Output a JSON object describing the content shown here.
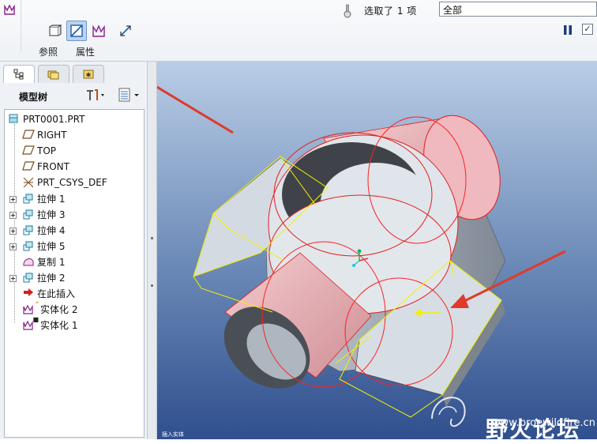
{
  "dashboard": {
    "tools": [
      {
        "label": "参照"
      },
      {
        "label": "属性"
      }
    ],
    "selection_status": "选取了 1 项",
    "filter_value": "全部",
    "ok_glyph": "✓"
  },
  "navigator": {
    "tree_title": "模型树",
    "items": [
      {
        "label": "PRT0001.PRT",
        "icon": "part-icon",
        "level": 0
      },
      {
        "label": "RIGHT",
        "icon": "datum-plane-icon",
        "level": 1
      },
      {
        "label": "TOP",
        "icon": "datum-plane-icon",
        "level": 1
      },
      {
        "label": "FRONT",
        "icon": "datum-plane-icon",
        "level": 1
      },
      {
        "label": "PRT_CSYS_DEF",
        "icon": "csys-icon",
        "level": 1
      },
      {
        "label": "拉伸 1",
        "icon": "extrude-icon",
        "level": 1,
        "expandable": true
      },
      {
        "label": "拉伸 3",
        "icon": "extrude-icon",
        "level": 1,
        "expandable": true
      },
      {
        "label": "拉伸 4",
        "icon": "extrude-icon",
        "level": 1,
        "expandable": true
      },
      {
        "label": "拉伸 5",
        "icon": "extrude-icon",
        "level": 1,
        "expandable": true
      },
      {
        "label": "复制 1",
        "icon": "copy-icon",
        "level": 1
      },
      {
        "label": "拉伸 2",
        "icon": "extrude-icon",
        "level": 1,
        "expandable": true
      },
      {
        "label": "在此插入",
        "icon": "insert-here-arrow-icon",
        "level": 1
      },
      {
        "label": "实体化 2",
        "icon": "solidify-icon",
        "level": 1
      },
      {
        "label": "实体化 1",
        "icon": "solidify-icon",
        "level": 1
      }
    ]
  },
  "graphics": {
    "status_text": "插入实体",
    "watermark_title": "野火论坛",
    "watermark_url": "www.proewildfire.cn"
  },
  "colors": {
    "arrow": "#e03a2a",
    "preview_yellow": "#f2f200",
    "highlight_red": "#ff2020",
    "surface_pink": "#e3a7ad",
    "body_grey": "#9aa3ae"
  }
}
